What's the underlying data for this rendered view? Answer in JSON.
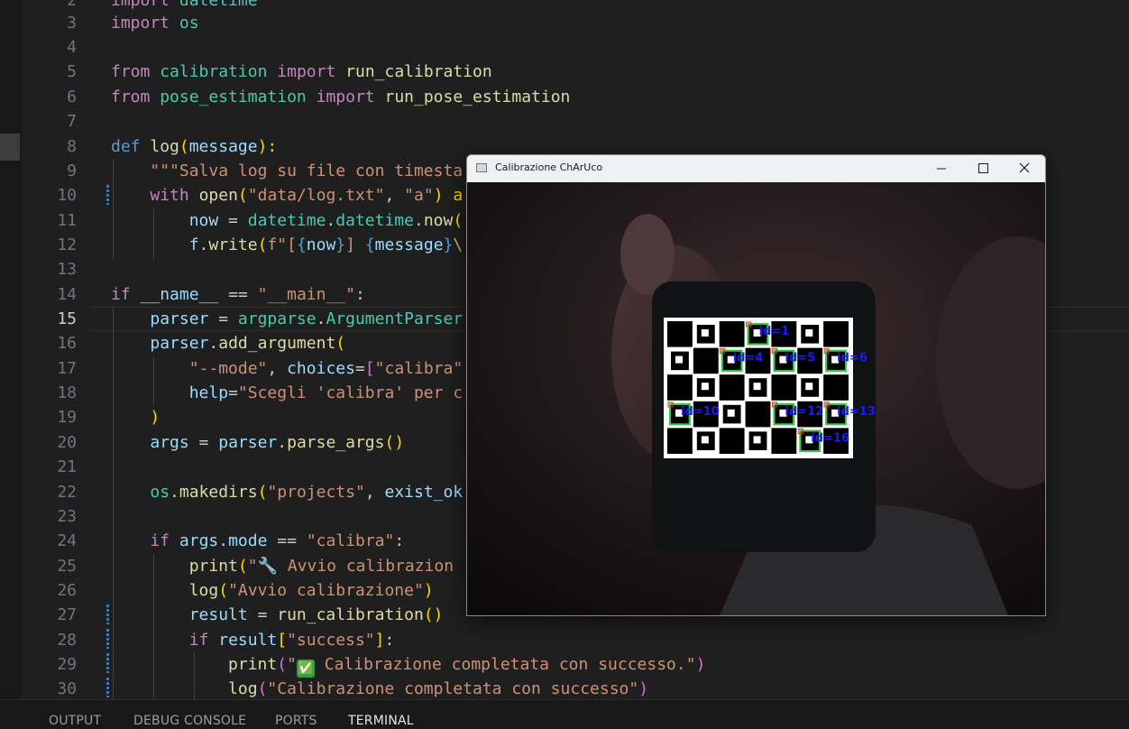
{
  "editor": {
    "lines": [
      {
        "n": "2"
      },
      {
        "n": "3"
      },
      {
        "n": "4"
      },
      {
        "n": "5"
      },
      {
        "n": "6"
      },
      {
        "n": "7"
      },
      {
        "n": "8"
      },
      {
        "n": "9"
      },
      {
        "n": "10"
      },
      {
        "n": "11"
      },
      {
        "n": "12"
      },
      {
        "n": "13"
      },
      {
        "n": "14"
      },
      {
        "n": "15"
      },
      {
        "n": "16"
      },
      {
        "n": "17"
      },
      {
        "n": "18"
      },
      {
        "n": "19"
      },
      {
        "n": "20"
      },
      {
        "n": "21"
      },
      {
        "n": "22"
      },
      {
        "n": "23"
      },
      {
        "n": "24"
      },
      {
        "n": "25"
      },
      {
        "n": "26"
      },
      {
        "n": "27"
      },
      {
        "n": "28"
      },
      {
        "n": "29"
      },
      {
        "n": "30"
      }
    ],
    "active_line": "15",
    "code": {
      "l2": [
        "import",
        "datetime"
      ],
      "l3": [
        "import",
        "os"
      ],
      "l5": [
        "from",
        "calibration",
        "import",
        "run_calibration"
      ],
      "l6": [
        "from",
        "pose_estimation",
        "import",
        "run_pose_estimation"
      ],
      "l8": [
        "def",
        "log",
        "(",
        "message",
        "):"
      ],
      "l9": [
        "\"\"\"Salva log su file con timesta"
      ],
      "l10": [
        "with",
        "open",
        "(",
        "\"data/log.txt\"",
        ", ",
        "\"a\"",
        ") a"
      ],
      "l11": [
        "now",
        " = ",
        "datetime",
        ".",
        "datetime",
        ".",
        "now",
        "("
      ],
      "l12": [
        "f",
        ".",
        "write",
        "(",
        "f\"[",
        "{",
        "now",
        "}",
        "] ",
        "{",
        "message",
        "}",
        "\\"
      ],
      "l14": [
        "if",
        "__name__",
        " == ",
        "\"__main__\"",
        ":"
      ],
      "l15": [
        "parser",
        " = ",
        "argparse",
        ".",
        "ArgumentParser"
      ],
      "l16": [
        "parser",
        ".",
        "add_argument",
        "("
      ],
      "l17": [
        "\"--mode\"",
        ", ",
        "choices",
        "=",
        "[",
        "\"calibra\""
      ],
      "l18": [
        "help",
        "=",
        "\"Scegli 'calibra' per c"
      ],
      "l19": [
        ")"
      ],
      "l20": [
        "args",
        " = ",
        "parser",
        ".",
        "parse_args",
        "()"
      ],
      "l22": [
        "os",
        ".",
        "makedirs",
        "(",
        "\"projects\"",
        ", ",
        "exist_ok"
      ],
      "l24": [
        "if",
        "args",
        ".",
        "mode",
        " == ",
        "\"calibra\"",
        ":"
      ],
      "l25": [
        "print",
        "(",
        "\"🔧 Avvio calibrazion"
      ],
      "l26": [
        "log",
        "(",
        "\"Avvio calibrazione\"",
        ")"
      ],
      "l27": [
        "result",
        " = ",
        "run_calibration",
        "()"
      ],
      "l28": [
        "if",
        "result",
        "[",
        "\"success\"",
        "]",
        ":"
      ],
      "l29": [
        "print",
        "(",
        "\"",
        "✅",
        " Calibrazione completata con successo.\"",
        ")"
      ],
      "l30": [
        "log",
        "(",
        "\"Calibrazione completata con successo\"",
        ")"
      ]
    }
  },
  "panel": {
    "tabs": [
      "OUTPUT",
      "DEBUG CONSOLE",
      "PORTS",
      "TERMINAL"
    ],
    "active_tab": "TERMINAL"
  },
  "window": {
    "title": "Calibrazione ChArUco",
    "buttons": [
      "minimize-icon",
      "maximize-icon",
      "close-icon"
    ],
    "markers": [
      "id=1",
      "id=4",
      "id=5",
      "id=6",
      "id=10",
      "id=12",
      "id=13",
      "id=16"
    ]
  },
  "colors": {
    "keyword": "#c586c0",
    "def_keyword": "#569cd6",
    "function": "#dcdcaa",
    "variable": "#9cdcfe",
    "string": "#ce9178",
    "module": "#4ec9b0",
    "marker_label": "#1a1aff",
    "marker_box": "#2ecc40"
  }
}
